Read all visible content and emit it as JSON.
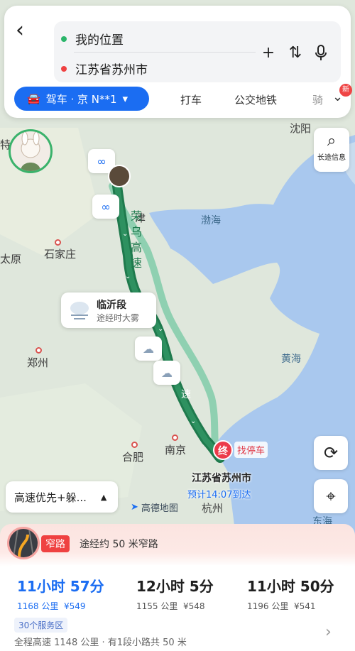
{
  "top": {
    "from": "我的位置",
    "to": "江苏省苏州市",
    "drive_tab": "驾车 · 京 N**1",
    "tabs": [
      "打车",
      "公交地铁",
      "骑"
    ],
    "new_badge": "新"
  },
  "map": {
    "cities": [
      "沈阳",
      "太原",
      "石家庄",
      "郑州",
      "合肥",
      "南京",
      "杭州",
      "津",
      "特"
    ],
    "seas": [
      "渤海",
      "黄海",
      "东海"
    ],
    "highway_label": "荣乌高速",
    "highway_label2": "速",
    "long_info_label": "长途信息",
    "weather": {
      "title": "临沂段",
      "subtitle": "途经时大雾"
    },
    "dest_marker": "终",
    "parking": "找停车",
    "dest_name": "江苏省苏州市",
    "eta": "预计14:07到达",
    "route_pref": "高速优先+躲...",
    "logo": "高德地图",
    "colors": {
      "route_main": "#1f7a4d",
      "route_alt": "#8fd0b1",
      "brand_blue": "#1b6df2"
    }
  },
  "bottom": {
    "narrow_tag": "窄路",
    "narrow_desc": "途经约 50 米窄路",
    "routes": [
      {
        "time": "11小时 57分",
        "distance": "1168 公里",
        "toll": "¥549"
      },
      {
        "time": "12小时 5分",
        "distance": "1155 公里",
        "toll": "¥548"
      },
      {
        "time": "11小时 50分",
        "distance": "1196 公里",
        "toll": "¥541"
      }
    ],
    "service": "30个服务区",
    "summary": "全程高速 1148 公里 · 有1段小路共 50 米"
  }
}
